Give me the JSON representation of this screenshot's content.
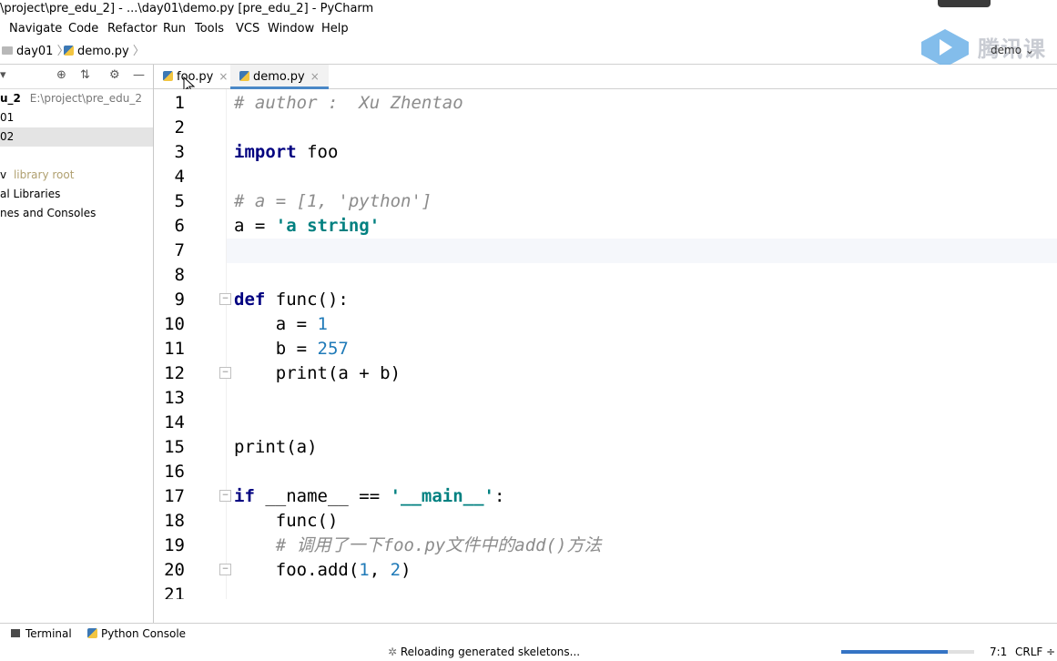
{
  "window": {
    "title": "\\project\\pre_edu_2] - ...\\day01\\demo.py [pre_edu_2] - PyCharm"
  },
  "menu": [
    "Navigate",
    "Code",
    "Refactor",
    "Run",
    "Tools",
    "VCS",
    "Window",
    "Help"
  ],
  "breadcrumb": {
    "folder": "day01",
    "file": "demo.py"
  },
  "run_config": "demo",
  "watermark": "腾讯课堂",
  "project": {
    "rows": [
      {
        "label": "u_2",
        "hint": "E:\\project\\pre_edu_2"
      },
      {
        "label": "01",
        "hint": ""
      },
      {
        "label": "02",
        "hint": ""
      },
      {
        "label": "",
        "hint": ""
      },
      {
        "label": "v",
        "hint": "library root"
      },
      {
        "label": "al Libraries",
        "hint": ""
      },
      {
        "label": "nes and Consoles",
        "hint": ""
      }
    ]
  },
  "tabs": [
    {
      "label": "foo.py",
      "close": "×"
    },
    {
      "label": "demo.py",
      "close": "×"
    }
  ],
  "editor": {
    "line_numbers": [
      "1",
      "2",
      "3",
      "4",
      "5",
      "6",
      "7",
      "8",
      "9",
      "10",
      "11",
      "12",
      "13",
      "14",
      "15",
      "16",
      "17",
      "18",
      "19",
      "20",
      "21"
    ],
    "lines": {
      "l1": "# author :  Xu Zhentao",
      "l3_kw": "import",
      "l3_rest": " foo",
      "l5": "# a = [1, 'python']",
      "l6_a": "a = ",
      "l6_str": "'a string'",
      "l9_kw": "def",
      "l9_rest": " func():",
      "l10_a": "    a = ",
      "l10_n": "1",
      "l11_a": "    b = ",
      "l11_n": "257",
      "l12": "    print(a + b)",
      "l15": "print(a)",
      "l17_kw": "if",
      "l17_mid": " __name__ == ",
      "l17_str": "'__main__'",
      "l17_end": ":",
      "l18": "    func()",
      "l19": "    # 调用了一下foo.py文件中的add()方法",
      "l20_a": "    foo.add(",
      "l20_n1": "1",
      "l20_mid": ", ",
      "l20_n2": "2",
      "l20_end": ")"
    }
  },
  "toolwindows": {
    "terminal": "Terminal",
    "python_console": "Python Console"
  },
  "status": {
    "message": "Reloading generated skeletons...",
    "position": "7:1",
    "line_sep": "CRLF ÷",
    "progress": 0.8
  },
  "colors": {
    "keyword": "#000080",
    "string": "#008080",
    "number": "#1f7ab8",
    "comment": "#8c8c8c",
    "accent": "#4a88c7"
  }
}
